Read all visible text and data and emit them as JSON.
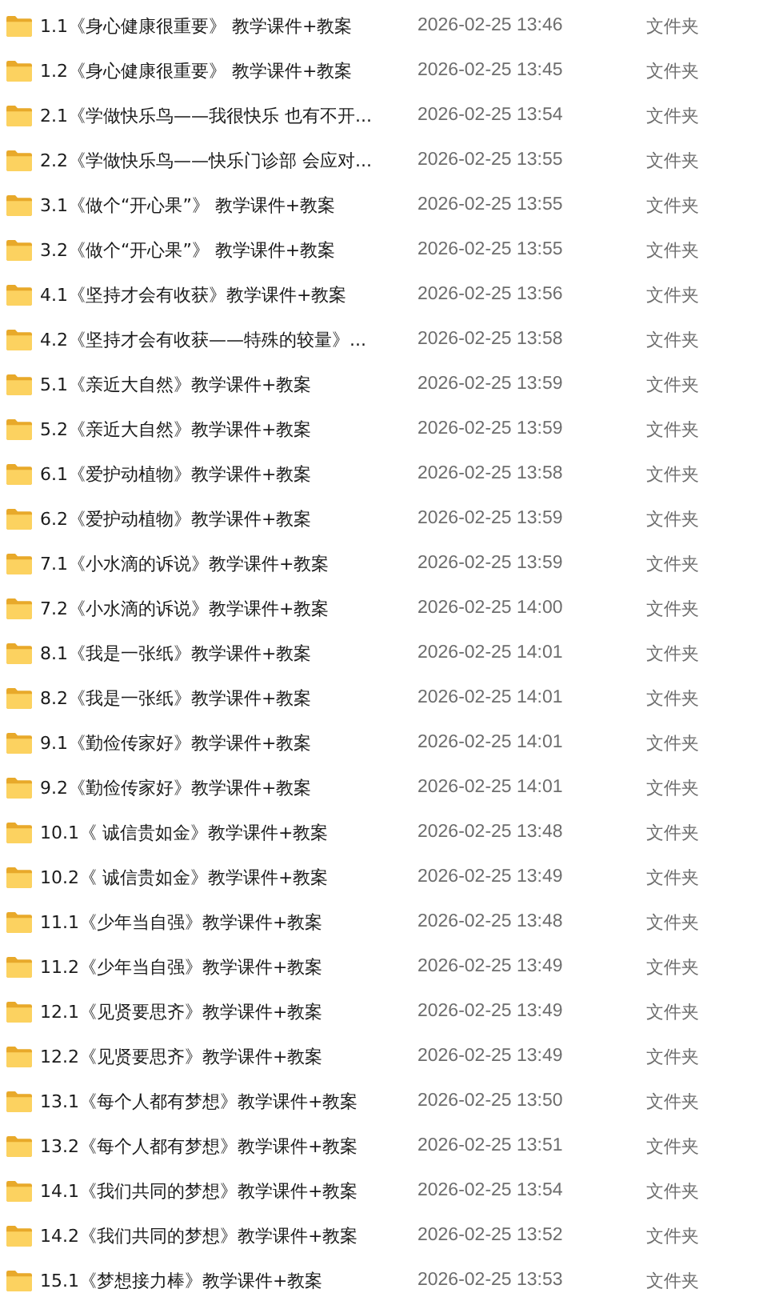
{
  "files": [
    {
      "name": "1.1《身心健康很重要》 教学课件+教案",
      "modified": "2026-02-25 13:46",
      "type": "文件夹"
    },
    {
      "name": "1.2《身心健康很重要》 教学课件+教案",
      "modified": "2026-02-25 13:45",
      "type": "文件夹"
    },
    {
      "name": "2.1《学做快乐鸟——我很快乐 也有不开...",
      "modified": "2026-02-25 13:54",
      "type": "文件夹"
    },
    {
      "name": "2.2《学做快乐鸟——快乐门诊部 会应对...",
      "modified": "2026-02-25 13:55",
      "type": "文件夹"
    },
    {
      "name": "3.1《做个“开心果”》 教学课件+教案",
      "modified": "2026-02-25 13:55",
      "type": "文件夹"
    },
    {
      "name": "3.2《做个“开心果”》 教学课件+教案",
      "modified": "2026-02-25 13:55",
      "type": "文件夹"
    },
    {
      "name": "4.1《坚持才会有收获》教学课件+教案",
      "modified": "2026-02-25 13:56",
      "type": "文件夹"
    },
    {
      "name": "4.2《坚持才会有收获——特殊的较量》...",
      "modified": "2026-02-25 13:58",
      "type": "文件夹"
    },
    {
      "name": "5.1《亲近大自然》教学课件+教案",
      "modified": "2026-02-25 13:59",
      "type": "文件夹"
    },
    {
      "name": "5.2《亲近大自然》教学课件+教案",
      "modified": "2026-02-25 13:59",
      "type": "文件夹"
    },
    {
      "name": "6.1《爱护动植物》教学课件+教案",
      "modified": "2026-02-25 13:58",
      "type": "文件夹"
    },
    {
      "name": "6.2《爱护动植物》教学课件+教案",
      "modified": "2026-02-25 13:59",
      "type": "文件夹"
    },
    {
      "name": "7.1《小水滴的诉说》教学课件+教案",
      "modified": "2026-02-25 13:59",
      "type": "文件夹"
    },
    {
      "name": "7.2《小水滴的诉说》教学课件+教案",
      "modified": "2026-02-25 14:00",
      "type": "文件夹"
    },
    {
      "name": "8.1《我是一张纸》教学课件+教案",
      "modified": "2026-02-25 14:01",
      "type": "文件夹"
    },
    {
      "name": "8.2《我是一张纸》教学课件+教案",
      "modified": "2026-02-25 14:01",
      "type": "文件夹"
    },
    {
      "name": "9.1《勤俭传家好》教学课件+教案",
      "modified": "2026-02-25 14:01",
      "type": "文件夹"
    },
    {
      "name": "9.2《勤俭传家好》教学课件+教案",
      "modified": "2026-02-25 14:01",
      "type": "文件夹"
    },
    {
      "name": "10.1《 诚信贵如金》教学课件+教案",
      "modified": "2026-02-25 13:48",
      "type": "文件夹"
    },
    {
      "name": "10.2《 诚信贵如金》教学课件+教案",
      "modified": "2026-02-25 13:49",
      "type": "文件夹"
    },
    {
      "name": "11.1《少年当自强》教学课件+教案",
      "modified": "2026-02-25 13:48",
      "type": "文件夹"
    },
    {
      "name": "11.2《少年当自强》教学课件+教案",
      "modified": "2026-02-25 13:49",
      "type": "文件夹"
    },
    {
      "name": "12.1《见贤要思齐》教学课件+教案",
      "modified": "2026-02-25 13:49",
      "type": "文件夹"
    },
    {
      "name": "12.2《见贤要思齐》教学课件+教案",
      "modified": "2026-02-25 13:49",
      "type": "文件夹"
    },
    {
      "name": "13.1《每个人都有梦想》教学课件+教案",
      "modified": "2026-02-25 13:50",
      "type": "文件夹"
    },
    {
      "name": "13.2《每个人都有梦想》教学课件+教案",
      "modified": "2026-02-25 13:51",
      "type": "文件夹"
    },
    {
      "name": "14.1《我们共同的梦想》教学课件+教案",
      "modified": "2026-02-25 13:54",
      "type": "文件夹"
    },
    {
      "name": "14.2《我们共同的梦想》教学课件+教案",
      "modified": "2026-02-25 13:52",
      "type": "文件夹"
    },
    {
      "name": "15.1《梦想接力棒》教学课件+教案",
      "modified": "2026-02-25 13:53",
      "type": "文件夹"
    }
  ]
}
